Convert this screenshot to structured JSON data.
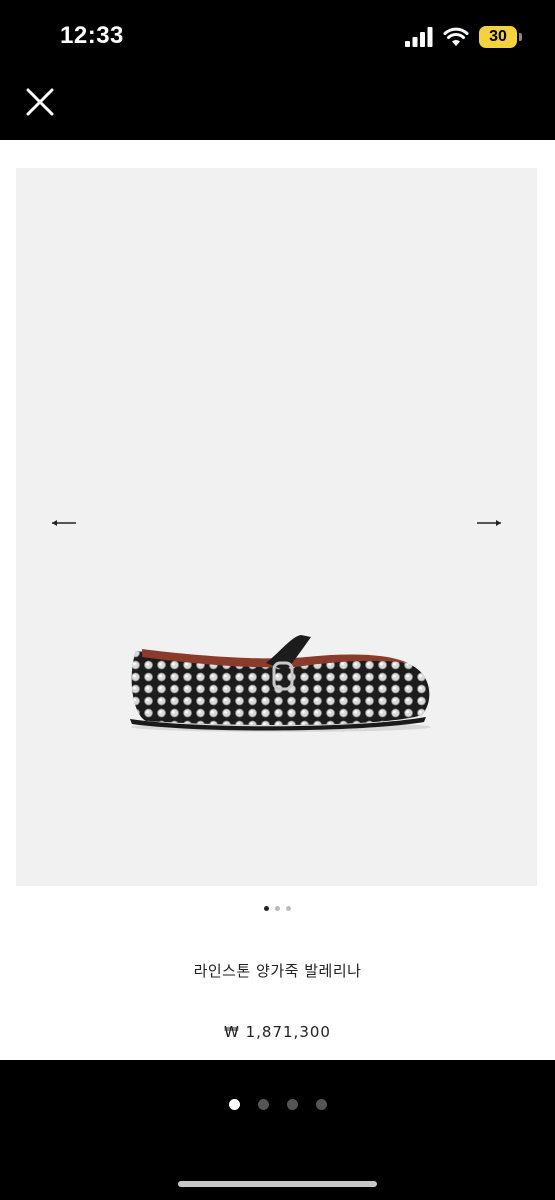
{
  "status_bar": {
    "time": "12:33",
    "battery": "30",
    "battery_color": "#f4d23d",
    "icons": [
      "signal-icon",
      "wifi-icon",
      "battery-icon"
    ]
  },
  "top_bar": {
    "close_icon": "close-icon"
  },
  "product": {
    "name": "라인스톤 양가죽 발레리나",
    "price": "₩ 1,871,300",
    "image_count": 3,
    "current_image": 1
  },
  "gallery": {
    "page_count": 4,
    "current_page": 1
  },
  "colors": {
    "background": "#000000",
    "sheet": "#ffffff",
    "image_bg": "#f1f1f1"
  }
}
